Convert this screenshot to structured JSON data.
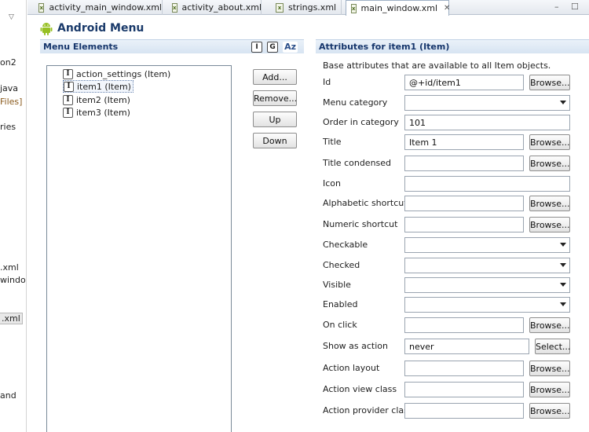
{
  "explorer": {
    "fragments": [
      "on2",
      "java",
      "Files]",
      "ries",
      ".xml",
      "windo",
      ".xml",
      "and"
    ]
  },
  "tabs": [
    {
      "label": "activity_main_window.xml"
    },
    {
      "label": "activity_about.xml"
    },
    {
      "label": "strings.xml"
    },
    {
      "label": "main_window.xml",
      "close": "✕"
    }
  ],
  "window_controls": {
    "minimize": "–",
    "maximize": "☐"
  },
  "header": {
    "title": "Android Menu"
  },
  "menu_elements": {
    "title": "Menu Elements",
    "sort_buttons": [
      "I",
      "G",
      "Az"
    ],
    "items": [
      {
        "icon": "I",
        "label": "action_settings (Item)"
      },
      {
        "icon": "I",
        "label": "item1 (Item)"
      },
      {
        "icon": "I",
        "label": "item2 (Item)"
      },
      {
        "icon": "I",
        "label": "item3 (Item)"
      }
    ],
    "buttons": {
      "add": "Add...",
      "remove": "Remove...",
      "up": "Up",
      "down": "Down"
    }
  },
  "attributes": {
    "title": "Attributes for item1 (Item)",
    "description": "Base attributes that are available to all Item objects.",
    "rows": [
      {
        "label": "Id",
        "type": "text",
        "value": "@+id/item1",
        "button": "Browse..."
      },
      {
        "label": "Menu category",
        "type": "select",
        "value": ""
      },
      {
        "label": "Order in category",
        "type": "text",
        "value": "101"
      },
      {
        "label": "Title",
        "type": "text",
        "value": "Item 1",
        "button": "Browse..."
      },
      {
        "label": "Title condensed",
        "type": "text",
        "value": "",
        "button": "Browse..."
      },
      {
        "label": "Icon",
        "type": "text",
        "value": ""
      },
      {
        "label": "Alphabetic shortcut",
        "type": "text",
        "value": "",
        "button": "Browse..."
      },
      {
        "label": "Numeric shortcut",
        "type": "text",
        "value": "",
        "button": "Browse..."
      },
      {
        "label": "Checkable",
        "type": "select",
        "value": ""
      },
      {
        "label": "Checked",
        "type": "select",
        "value": ""
      },
      {
        "label": "Visible",
        "type": "select",
        "value": ""
      },
      {
        "label": "Enabled",
        "type": "select",
        "value": ""
      },
      {
        "label": "On click",
        "type": "text",
        "value": "",
        "button": "Browse..."
      },
      {
        "label": "Show as action",
        "type": "text",
        "value": "never",
        "button": "Select..."
      },
      {
        "label": "Action layout",
        "type": "text",
        "value": "",
        "button": "Browse..."
      },
      {
        "label": "Action view class",
        "type": "text",
        "value": "",
        "button": "Browse..."
      },
      {
        "label": "Action provider class",
        "type": "text",
        "value": "",
        "button": "Browse..."
      }
    ]
  },
  "colors": {
    "header_title": "#1a3a6a",
    "section_header": "#d7e4f2",
    "android_green": "#97c024"
  }
}
